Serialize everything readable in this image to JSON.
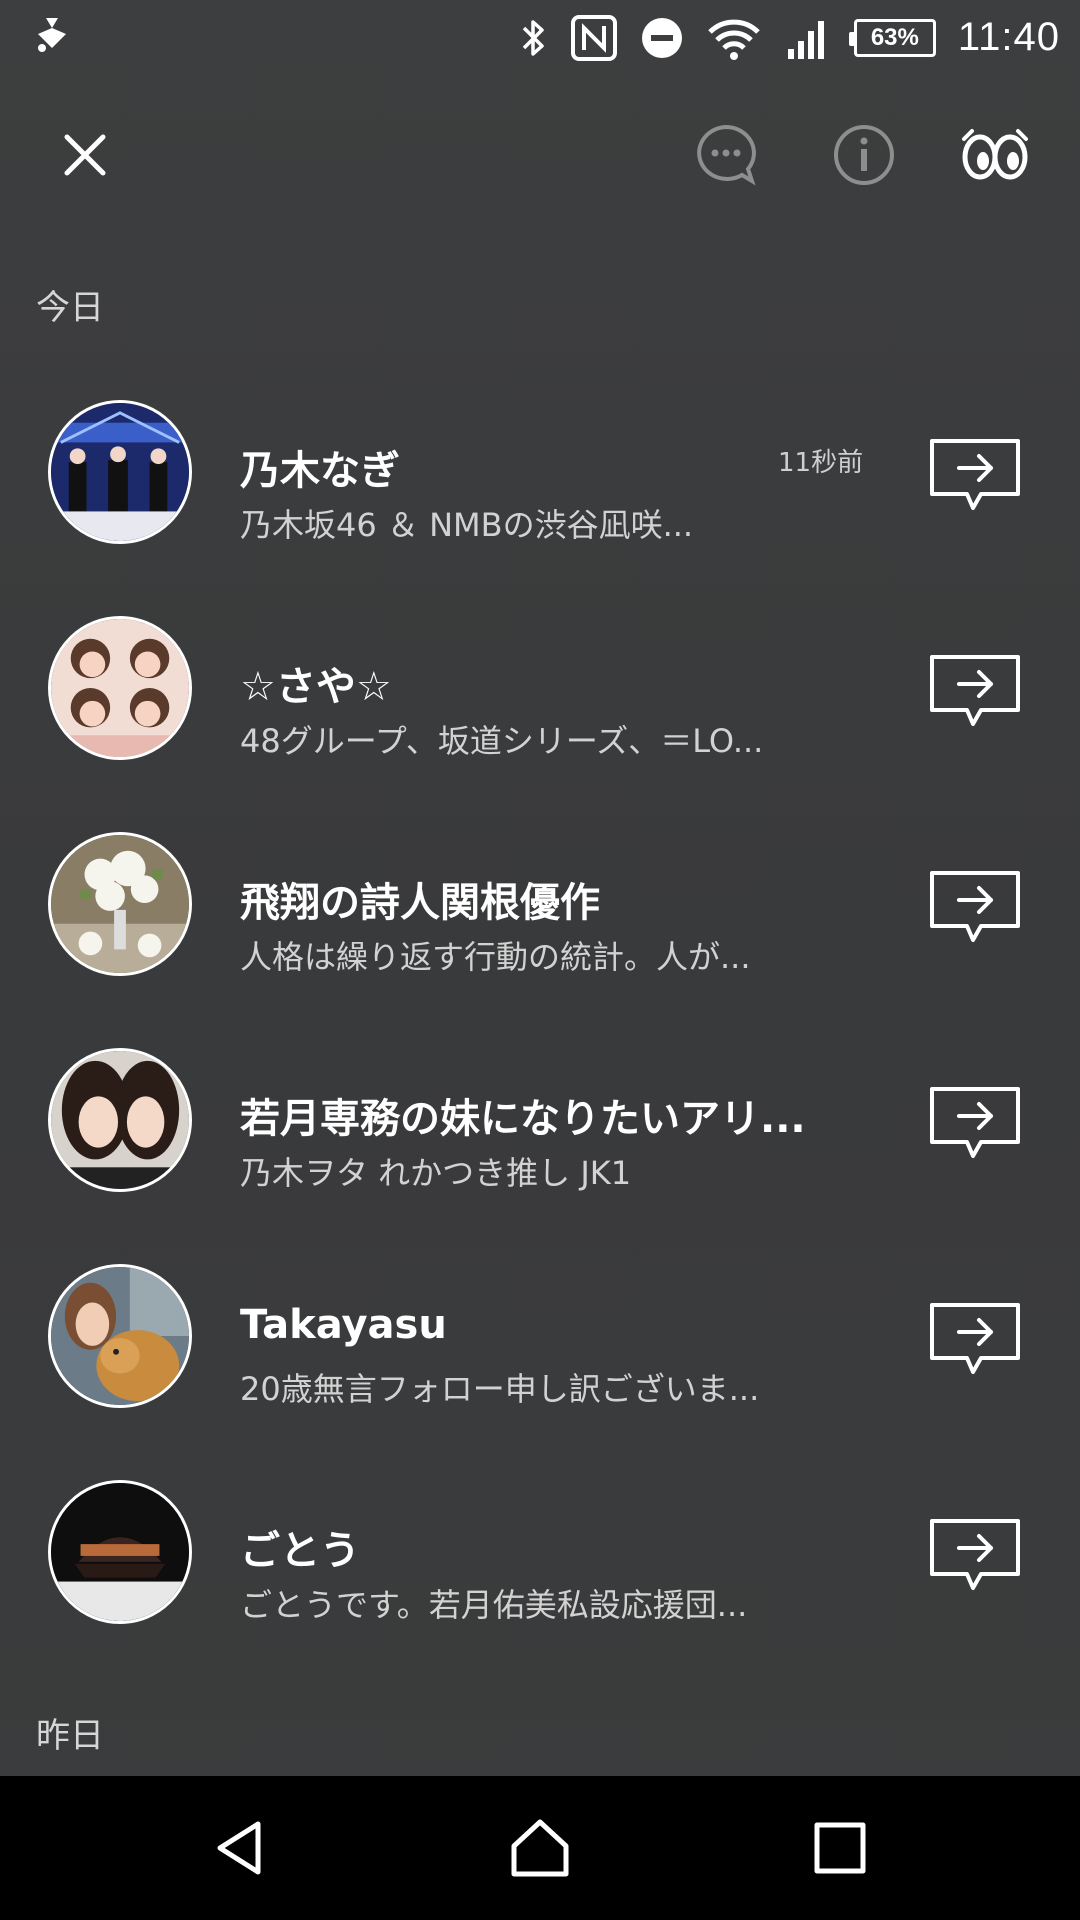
{
  "status_bar": {
    "battery": "63%",
    "time": "11:40",
    "icons": [
      "notification-icon",
      "bluetooth-icon",
      "nfc-icon",
      "dnd-icon",
      "wifi-icon",
      "signal-icon",
      "battery-icon"
    ]
  },
  "toolbar": {
    "icons": [
      "close-icon",
      "chat-bubble-icon",
      "info-icon",
      "eyes-icon"
    ]
  },
  "sections": {
    "today": "今日",
    "yesterday": "昨日"
  },
  "rows": [
    {
      "name": "乃木なぎ",
      "subtitle": "乃木坂46 ＆ NMBの渋谷凪咲...",
      "time": "11秒前"
    },
    {
      "name": "☆さや☆",
      "subtitle": "48グループ、坂道シリーズ、＝LO...",
      "time": ""
    },
    {
      "name": "飛翔の詩人関根優作",
      "subtitle": "人格は繰り返す行動の統計。人が...",
      "time": ""
    },
    {
      "name": "若月専務の妹になりたいアリ...",
      "subtitle": "乃木ヲタ れかつき推し JK1",
      "time": ""
    },
    {
      "name": "Takayasu",
      "subtitle": "20歳無言フォロー申し訳ございま...",
      "time": ""
    },
    {
      "name": "ごとう",
      "subtitle": "ごとうです。若月佑美私設応援団...",
      "time": ""
    }
  ],
  "nav": {
    "icons": [
      "back-icon",
      "home-icon",
      "recent-apps-icon"
    ]
  }
}
